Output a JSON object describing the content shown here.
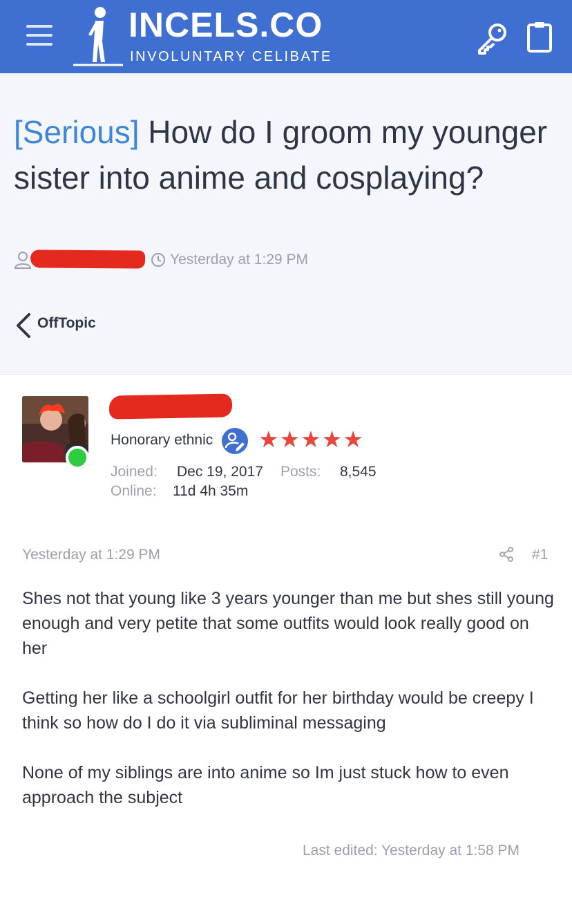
{
  "header": {
    "site_name": "INCELS.CO",
    "tagline": "INVOLUNTARY CELIBATE",
    "bg_color": "#3f6fd1"
  },
  "thread": {
    "prefix": "[Serious]",
    "title": " How do I groom my younger sister into anime and cosplaying?",
    "timestamp": "Yesterday at 1:29 PM",
    "forum": "OffTopic"
  },
  "post": {
    "user_title": "Honorary ethnic",
    "stars": "★★★★★",
    "joined_label": "Joined:",
    "joined_value": "Dec 19, 2017",
    "posts_label": "Posts:",
    "posts_value": "8,545",
    "online_label": "Online:",
    "online_value": "11d 4h 35m",
    "date": "Yesterday at 1:29 PM",
    "number": "#1",
    "paragraphs": [
      "Shes not that young like 3 years younger than me but shes still young enough and very petite that some outfits would look really good on her",
      "Getting her like a schoolgirl outfit for her birthday would be creepy I think so how do I do it via subliminal messaging",
      "None of my siblings are into anime so Im just stuck how to even approach the subject"
    ],
    "last_edited": "Last edited: Yesterday at 1:58 PM"
  },
  "icons": {
    "menu": "hamburger-icon",
    "logo": "stick-figure-logo",
    "login": "key-icon",
    "register": "clipboard-icon",
    "author": "user-icon",
    "time": "clock-icon",
    "back": "chevron-left-icon",
    "badge": "user-edit-icon",
    "share": "share-icon"
  },
  "colors": {
    "prefix_blue": "#3d86d8",
    "star_red": "#e8453c",
    "online_green": "#2ecc40",
    "redaction_red": "#e42a1f"
  }
}
